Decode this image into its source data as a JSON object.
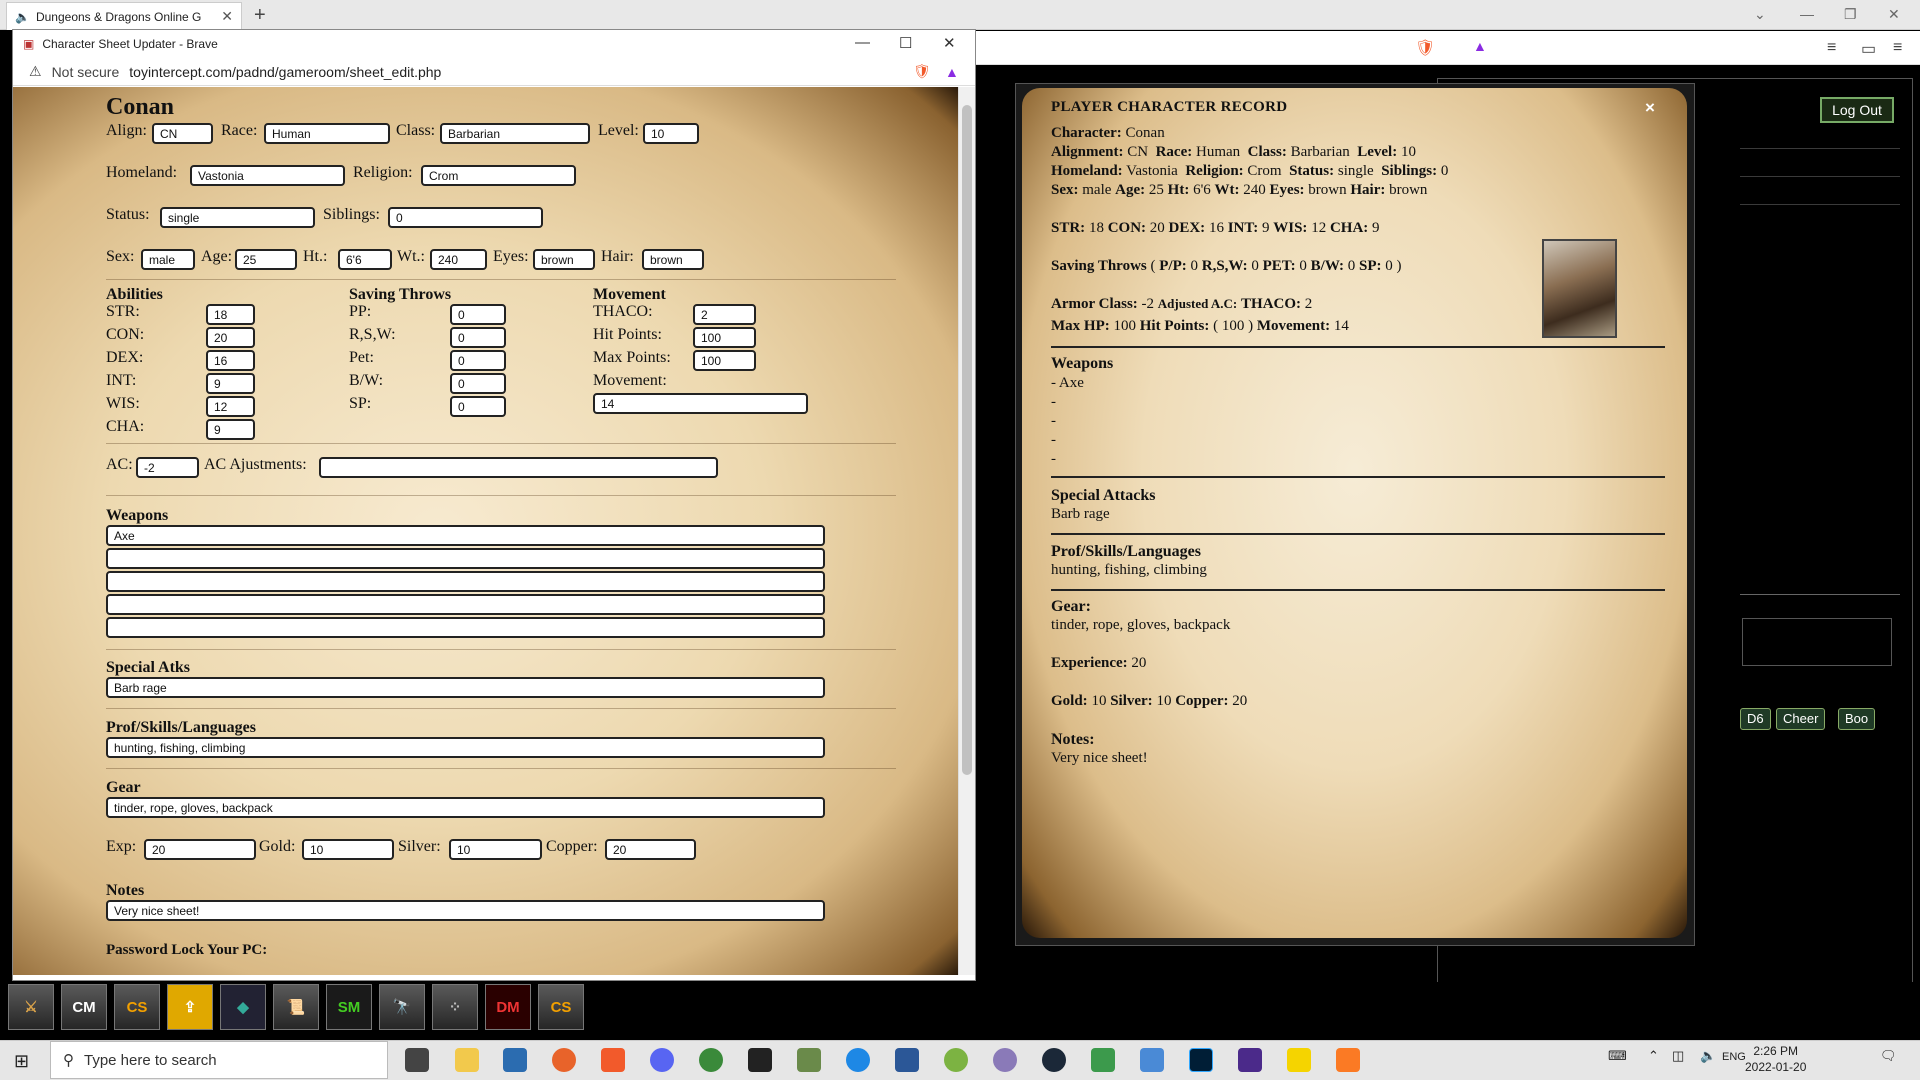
{
  "outer_browser": {
    "tab_title": "Dungeons & Dragons Online G",
    "logout_label": "Log Out",
    "dice_buttons": [
      "D6",
      "Cheer",
      "Boo"
    ]
  },
  "popup": {
    "window_title": "Character Sheet Updater - Brave",
    "security": "Not secure",
    "url": "toyintercept.com/padnd/gameroom/sheet_edit.php"
  },
  "sheet": {
    "name": "Conan",
    "labels": {
      "align": "Align:",
      "race": "Race:",
      "class": "Class:",
      "level": "Level:",
      "homeland": "Homeland:",
      "religion": "Religion:",
      "status": "Status:",
      "siblings": "Siblings:",
      "sex": "Sex:",
      "age": "Age:",
      "ht": "Ht.:",
      "wt": "Wt.:",
      "eyes": "Eyes:",
      "hair": "Hair:",
      "abilities": "Abilities",
      "saving_throws": "Saving Throws",
      "movement_h": "Movement",
      "str": "STR:",
      "con": "CON:",
      "dex": "DEX:",
      "int": "INT:",
      "wis": "WIS:",
      "cha": "CHA:",
      "pp": "PP:",
      "rsw": "R,S,W:",
      "pet": "Pet:",
      "bw": "B/W:",
      "sp": "SP:",
      "thaco": "THACO:",
      "hit_points": "Hit Points:",
      "max_points": "Max Points:",
      "movement": "Movement:",
      "ac": "AC:",
      "ac_adj": "AC Ajustments:",
      "weapons": "Weapons",
      "special_atks": "Special Atks",
      "prof": "Prof/Skills/Languages",
      "gear": "Gear",
      "exp": "Exp:",
      "gold": "Gold:",
      "silver": "Silver:",
      "copper": "Copper:",
      "notes": "Notes",
      "password": "Password Lock Your PC:"
    },
    "values": {
      "align": "CN",
      "race": "Human",
      "class": "Barbarian",
      "level": "10",
      "homeland": "Vastonia",
      "religion": "Crom",
      "status": "single",
      "siblings": "0",
      "sex": "male",
      "age": "25",
      "ht": "6'6",
      "wt": "240",
      "eyes": "brown",
      "hair": "brown",
      "str": "18",
      "con": "20",
      "dex": "16",
      "int": "9",
      "wis": "12",
      "cha": "9",
      "pp": "0",
      "rsw": "0",
      "pet": "0",
      "bw": "0",
      "sp": "0",
      "thaco": "2",
      "hit_points": "100",
      "max_points": "100",
      "movement": "14",
      "ac": "-2",
      "ac_adj": "",
      "weapons": [
        "Axe",
        "",
        "",
        "",
        ""
      ],
      "special_atks": "Barb rage",
      "prof": "hunting, fishing, climbing",
      "gear": "tinder, rope, gloves, backpack",
      "exp": "20",
      "gold": "10",
      "silver": "10",
      "copper": "20",
      "notes": "Very nice sheet!"
    }
  },
  "record": {
    "title": "PLAYER CHARACTER RECORD",
    "close": "×",
    "lines": {
      "character": "Character:",
      "character_v": "Conan",
      "alignment": "Alignment:",
      "alignment_v": "CN",
      "race": "Race:",
      "race_v": "Human",
      "class": "Class:",
      "class_v": "Barbarian",
      "level": "Level:",
      "level_v": "10",
      "homeland": "Homeland:",
      "homeland_v": "Vastonia",
      "religion": "Religion:",
      "religion_v": "Crom",
      "status": "Status:",
      "status_v": "single",
      "siblings": "Siblings:",
      "siblings_v": "0",
      "sex": "Sex:",
      "sex_v": "male",
      "age": "Age:",
      "age_v": "25",
      "ht": "Ht:",
      "ht_v": "6'6",
      "wt": "Wt:",
      "wt_v": "240",
      "eyes": "Eyes:",
      "eyes_v": "brown",
      "hair": "Hair:",
      "hair_v": "brown",
      "stats_str": "STR:",
      "str_v": "18",
      "stats_con": "CON:",
      "con_v": "20",
      "stats_dex": "DEX:",
      "dex_v": "16",
      "stats_int": "INT:",
      "int_v": "9",
      "stats_wis": "WIS:",
      "wis_v": "12",
      "stats_cha": "CHA:",
      "cha_v": "9",
      "saving": "Saving Throws",
      "saving_open": "(",
      "pp": "P/P:",
      "pp_v": "0",
      "rsw": "R,S,W:",
      "rsw_v": "0",
      "pet": "PET:",
      "pet_v": "0",
      "bw": "B/W:",
      "bw_v": "0",
      "sp": "SP:",
      "sp_v": "0",
      "saving_close": ")",
      "ac": "Armor Class:",
      "ac_v": "-2",
      "adj": "Adjusted A.C:",
      "thaco": "THACO:",
      "thaco_v": "2",
      "maxhp": "Max HP:",
      "maxhp_v": "100",
      "hp": "Hit Points:",
      "hp_v": "( 100 )",
      "mv": "Movement:",
      "mv_v": "14",
      "weapons": "Weapons",
      "weapon_lines": [
        "- Axe",
        "-",
        "-",
        "-",
        "-"
      ],
      "special": "Special Attacks",
      "special_v": "Barb rage",
      "prof": "Prof/Skills/Languages",
      "prof_v": "hunting, fishing, climbing",
      "gear": "Gear:",
      "gear_v": "tinder, rope, gloves, backpack",
      "exp": "Experience:",
      "exp_v": "20",
      "gold": "Gold:",
      "gold_v": "10",
      "silver": "Silver:",
      "silver_v": "10",
      "copper": "Copper:",
      "copper_v": "20",
      "notes": "Notes:",
      "notes_v": "Very nice sheet!"
    }
  },
  "launcher": [
    "CM",
    "CS",
    "SM",
    "DM",
    "CS"
  ],
  "taskbar": {
    "search_placeholder": "Type here to search",
    "lang": "ENG",
    "time": "2:26 PM",
    "date": "2022-01-20"
  }
}
